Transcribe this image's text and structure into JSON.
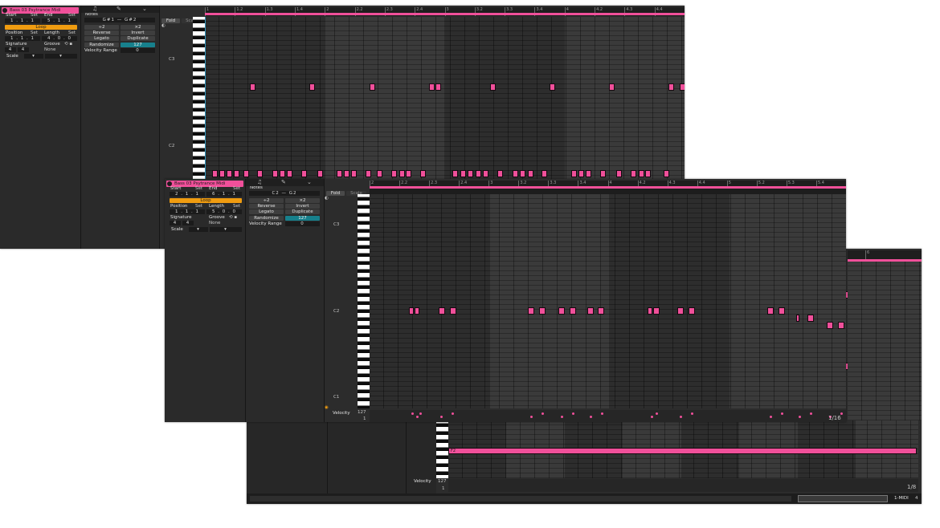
{
  "win1": {
    "clip_title": "Bass 03 Psytrance Midi",
    "start_label": "Start",
    "end_label": "End",
    "set_label": "Set",
    "start_value": "1 . 1 . 1",
    "end_value": "5 . 1 . 1",
    "loop_label": "Loop",
    "position_label": "Position",
    "length_label": "Length",
    "position_value": "1 . 1 . 1",
    "length_value": "4 . 0 . 0",
    "signature_label": "Signature",
    "groove_label": "Groove",
    "sig_num": "4",
    "sig_den": "4",
    "groove_value": "None",
    "scale_label": "Scale",
    "notes_label": "Notes",
    "notes_range": "G#1 — G#2",
    "div2": "÷2",
    "mul2": "×2",
    "reverse": "Reverse",
    "invert": "Invert",
    "legato": "Legato",
    "duplicate": "Duplicate",
    "randomize": "Randomize",
    "randomize_value": "127",
    "velocity_range_label": "Velocity Range",
    "velocity_range_value": "0",
    "fold": "Fold",
    "scale_btn": "Scale",
    "key_c3": "C3",
    "key_c2": "C2",
    "ruler": [
      "1",
      "1.2",
      "1.3",
      "1.4",
      "2",
      "2.2",
      "2.3",
      "2.4",
      "3",
      "3.2",
      "3.3",
      "3.4",
      "4",
      "4.2",
      "4.3",
      "4.4"
    ]
  },
  "win2": {
    "clip_title": "Bass 03 Psytrance Midi",
    "start_label": "Start",
    "end_label": "End",
    "set_label": "Set",
    "start_value": "2 . 1 . 1",
    "end_value": "6 . 1 . 1",
    "loop_label": "Loop",
    "position_label": "Position",
    "length_label": "Length",
    "position_value": "1 . 1 . 1",
    "length_value": "5 . 0 . 0",
    "signature_label": "Signature",
    "groove_label": "Groove",
    "sig_num": "4",
    "sig_den": "4",
    "groove_value": "None",
    "scale_label": "Scale",
    "notes_label": "Notes",
    "notes_range": "C2 — G2",
    "div2": "÷2",
    "mul2": "×2",
    "reverse": "Reverse",
    "invert": "Invert",
    "legato": "Legato",
    "duplicate": "Duplicate",
    "randomize": "Randomize",
    "randomize_value": "127",
    "velocity_range_label": "Velocity Range",
    "velocity_range_value": "0",
    "fold": "Fold",
    "scale_btn": "Scale",
    "key_c3": "C3",
    "key_c2": "C2",
    "key_c1": "C1",
    "velocity_label": "Velocity",
    "velocity_max": "127",
    "velocity_min": "1",
    "quantize": "1/16",
    "ruler": [
      "2",
      "2.2",
      "2.3",
      "2.4",
      "3",
      "3.2",
      "3.3",
      "3.4",
      "4",
      "4.2",
      "4.3",
      "4.4",
      "5",
      "5.2",
      "5.3",
      "5.4"
    ]
  },
  "win3": {
    "long_note_label": "F2",
    "velocity_label": "Velocity",
    "velocity_max": "127",
    "velocity_min": "1",
    "quantize": "1/8",
    "track_name": "1-MIDI",
    "ruler_mark": "6",
    "page_num": "4"
  },
  "colors": {
    "note": "#f0509a",
    "loop": "#f09c10",
    "teal": "#17808c",
    "bg": "#2c2c2c"
  },
  "icons": [
    "headphones-icon",
    "pencil-icon",
    "chevron-down-icon",
    "fold-toggle-icon",
    "loop-bracket-icon"
  ]
}
